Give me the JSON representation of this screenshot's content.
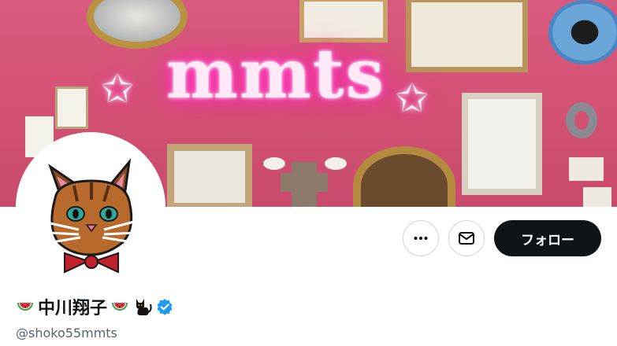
{
  "banner": {
    "neon_text": "mmts",
    "star_glyph": "✩"
  },
  "profile": {
    "display_name": "中川翔子",
    "handle": "@shoko55mmts",
    "verified": true,
    "name_emojis": [
      "watermelon-icon",
      "watermelon-icon",
      "black-cat-icon"
    ]
  },
  "actions": {
    "more_icon": "more-icon",
    "message_icon": "mail-icon",
    "follow_label": "フォロー"
  },
  "colors": {
    "banner_pink": "#d45274",
    "follow_bg": "#0f1419",
    "verified_blue": "#1d9bf0"
  }
}
